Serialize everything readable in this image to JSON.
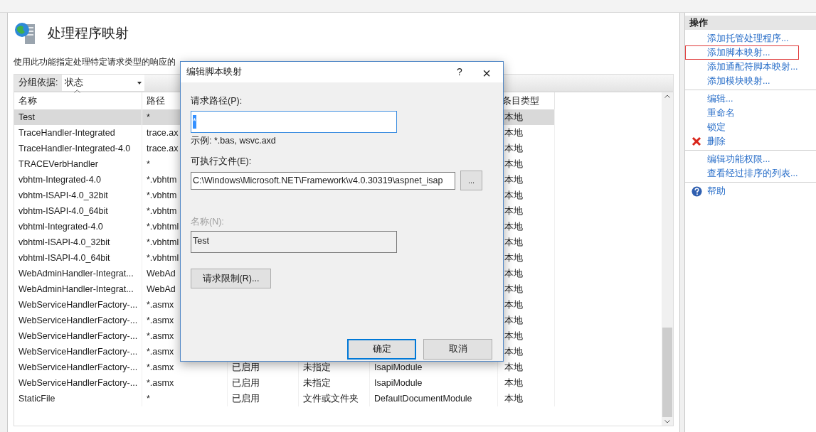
{
  "page": {
    "title": "处理程序映射",
    "description": "使用此功能指定处理特定请求类型的响应的"
  },
  "group_by": {
    "label": "分组依据:",
    "value": "状态"
  },
  "table": {
    "columns": [
      {
        "label": "名称",
        "sorted": true
      },
      {
        "label": "路径",
        "sorted": false
      },
      {},
      {},
      {},
      {
        "label": "条目类型",
        "sorted": false
      }
    ],
    "rows": [
      {
        "selected": true,
        "cells": [
          "Test",
          "*",
          null,
          null,
          null,
          "本地"
        ]
      },
      {
        "selected": false,
        "cells": [
          "TraceHandler-Integrated",
          "trace.ax",
          null,
          null,
          null,
          "本地"
        ]
      },
      {
        "selected": false,
        "cells": [
          "TraceHandler-Integrated-4.0",
          "trace.ax",
          null,
          null,
          null,
          "本地"
        ]
      },
      {
        "selected": false,
        "cells": [
          "TRACEVerbHandler",
          "*",
          null,
          null,
          null,
          "本地"
        ]
      },
      {
        "selected": false,
        "cells": [
          "vbhtm-Integrated-4.0",
          "*.vbhtm",
          null,
          null,
          null,
          "本地"
        ]
      },
      {
        "selected": false,
        "cells": [
          "vbhtm-ISAPI-4.0_32bit",
          "*.vbhtm",
          null,
          null,
          null,
          "本地"
        ]
      },
      {
        "selected": false,
        "cells": [
          "vbhtm-ISAPI-4.0_64bit",
          "*.vbhtm",
          null,
          null,
          null,
          "本地"
        ]
      },
      {
        "selected": false,
        "cells": [
          "vbhtml-Integrated-4.0",
          "*.vbhtml",
          null,
          null,
          null,
          "本地"
        ]
      },
      {
        "selected": false,
        "cells": [
          "vbhtml-ISAPI-4.0_32bit",
          "*.vbhtml",
          null,
          null,
          null,
          "本地"
        ]
      },
      {
        "selected": false,
        "cells": [
          "vbhtml-ISAPI-4.0_64bit",
          "*.vbhtml",
          null,
          null,
          null,
          "本地"
        ]
      },
      {
        "selected": false,
        "cells": [
          "WebAdminHandler-Integrat...",
          "WebAd",
          null,
          null,
          null,
          "本地"
        ]
      },
      {
        "selected": false,
        "cells": [
          "WebAdminHandler-Integrat...",
          "WebAd",
          null,
          null,
          null,
          "本地"
        ]
      },
      {
        "selected": false,
        "cells": [
          "WebServiceHandlerFactory-...",
          "*.asmx",
          null,
          null,
          null,
          "本地"
        ]
      },
      {
        "selected": false,
        "cells": [
          "WebServiceHandlerFactory-...",
          "*.asmx",
          null,
          null,
          null,
          "本地"
        ]
      },
      {
        "selected": false,
        "cells": [
          "WebServiceHandlerFactory-...",
          "*.asmx",
          null,
          null,
          null,
          "本地"
        ]
      },
      {
        "selected": false,
        "cells": [
          "WebServiceHandlerFactory-...",
          "*.asmx",
          null,
          null,
          null,
          "本地"
        ]
      },
      {
        "selected": false,
        "cells": [
          "WebServiceHandlerFactory-...",
          "*.asmx",
          "已启用",
          "未指定",
          "IsapiModule",
          "本地"
        ]
      },
      {
        "selected": false,
        "cells": [
          "WebServiceHandlerFactory-...",
          "*.asmx",
          "已启用",
          "未指定",
          "IsapiModule",
          "本地"
        ]
      },
      {
        "selected": false,
        "cells": [
          "StaticFile",
          "*",
          "已启用",
          "文件或文件夹",
          "DefaultDocumentModule",
          "本地"
        ]
      }
    ]
  },
  "actions": {
    "title": "操作",
    "groups": [
      [
        {
          "label": "添加托管处理程序...",
          "kind": "link",
          "highlighted": false
        },
        {
          "label": "添加脚本映射...",
          "kind": "link",
          "highlighted": true
        },
        {
          "label": "添加通配符脚本映射...",
          "kind": "link",
          "highlighted": false
        },
        {
          "label": "添加模块映射...",
          "kind": "link",
          "highlighted": false
        }
      ],
      [
        {
          "label": "编辑...",
          "kind": "link",
          "highlighted": false
        },
        {
          "label": "重命名",
          "kind": "link",
          "highlighted": false
        },
        {
          "label": "锁定",
          "kind": "link",
          "highlighted": false
        },
        {
          "label": "删除",
          "kind": "delete",
          "highlighted": false
        }
      ],
      [
        {
          "label": "编辑功能权限...",
          "kind": "link",
          "highlighted": false
        },
        {
          "label": "查看经过排序的列表...",
          "kind": "link",
          "highlighted": false
        }
      ],
      [
        {
          "label": "帮助",
          "kind": "help",
          "highlighted": false
        }
      ]
    ]
  },
  "dialog": {
    "title": "编辑脚本映射",
    "help_button": "?",
    "close_button": "×",
    "request_path": {
      "label": "请求路径(P):",
      "value": "*",
      "text_selected": true,
      "focused": true,
      "disabled": false
    },
    "example": "示例: *.bas, wsvc.axd",
    "executable": {
      "label": "可执行文件(E):",
      "value": "C:\\Windows\\Microsoft.NET\\Framework\\v4.0.30319\\aspnet_isap",
      "disabled": false,
      "browse_button": "..."
    },
    "name": {
      "label": "名称(N):",
      "value": "Test",
      "disabled": true
    },
    "restrictions_button": "请求限制(R)...",
    "ok_button": {
      "label": "确定",
      "default": true
    },
    "cancel_button": {
      "label": "取消",
      "default": false
    }
  }
}
